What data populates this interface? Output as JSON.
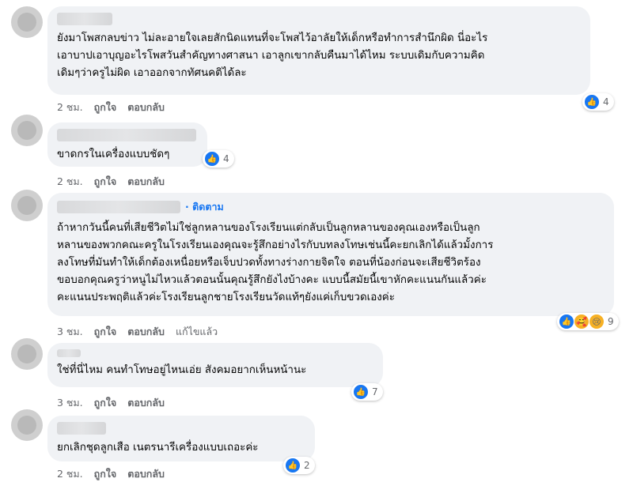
{
  "comments": [
    {
      "text": "ยังมาโพสกลบข่าว ไม่ละอายใจเลยสักนิดแทนที่จะโพสไว้อาลัยให้เด็กหรือทำการสำนึกผิด นี่อะไร\nเอาบาปเอาบุญอะไรโพสวันสำคัญทางศาสนา เอาลูกเขากลับคืนมาได้ไหม ระบบเดิมกับความคิด\nเดิมๆว่าครูไม่ผิด เอาออกจากทัศนคติได้ละ",
      "time": "2 ชม.",
      "like": "ถูกใจ",
      "reply": "ตอบกลับ",
      "reactions": "4"
    },
    {
      "text": "ขาดกรในเครื่องแบบชัดๆ",
      "time": "2 ชม.",
      "like": "ถูกใจ",
      "reply": "ตอบกลับ",
      "reactions": "4"
    },
    {
      "follow": "· ติดตาม",
      "text": "ถ้าหากวันนี้คนที่เสียชีวิตไม่ใช่ลูกหลานของโรงเรียนแต่กลับเป็นลูกหลานของคุณเองหรือเป็นลูก\nหลานของพวกคณะครูในโรงเรียนเองคุณจะรู้สึกอย่างไรกับบทลงโทษเช่นนี้คะยกเลิกได้แล้วมั้งการ\nลงโทษที่มันทำให้เด็กต้องเหนื่อยหรือเจ็บปวดทั้งทางร่างกายจิตใจ ตอนที่น้องก่อนจะเสียชีวิตร้อง\nขอบอกคุณครูว่าหนูไม่ไหวแล้วตอนนั้นคุณรู้สึกยังไงบ้างคะ แบบนี้สมัยนี้เขาหักคะแนนกันแล้วค่ะ\nคะแนนประพฤติแล้วค่ะโรงเรียนลูกชายโรงเรียนวัดแท้ๆยังแค่เก็บขวดเองค่ะ",
      "time": "3 ชม.",
      "like": "ถูกใจ",
      "reply": "ตอบกลับ",
      "edited": "แก้ไขแล้ว",
      "reactions": "9"
    },
    {
      "text": "ใช่ที่นี่ไหม คนทำโทษอยู่ไหนเอ่ย สังคมอยากเห็นหน้านะ",
      "time": "3 ชม.",
      "like": "ถูกใจ",
      "reply": "ตอบกลับ",
      "reactions": "7"
    },
    {
      "text": "ยกเลิกชุดลูกเสือ เนตรนารีเครื่องแบบเถอะค่ะ",
      "time": "2 ชม.",
      "like": "ถูกใจ",
      "reply": "ตอบกลับ",
      "reactions": "2"
    }
  ],
  "icons": {
    "like": "like-icon",
    "haha": "haha-icon",
    "care": "care-icon",
    "sad": "sad-icon"
  },
  "colors": {
    "bubble": "#f0f2f5",
    "link": "#1877f2",
    "meta": "#65676b"
  }
}
